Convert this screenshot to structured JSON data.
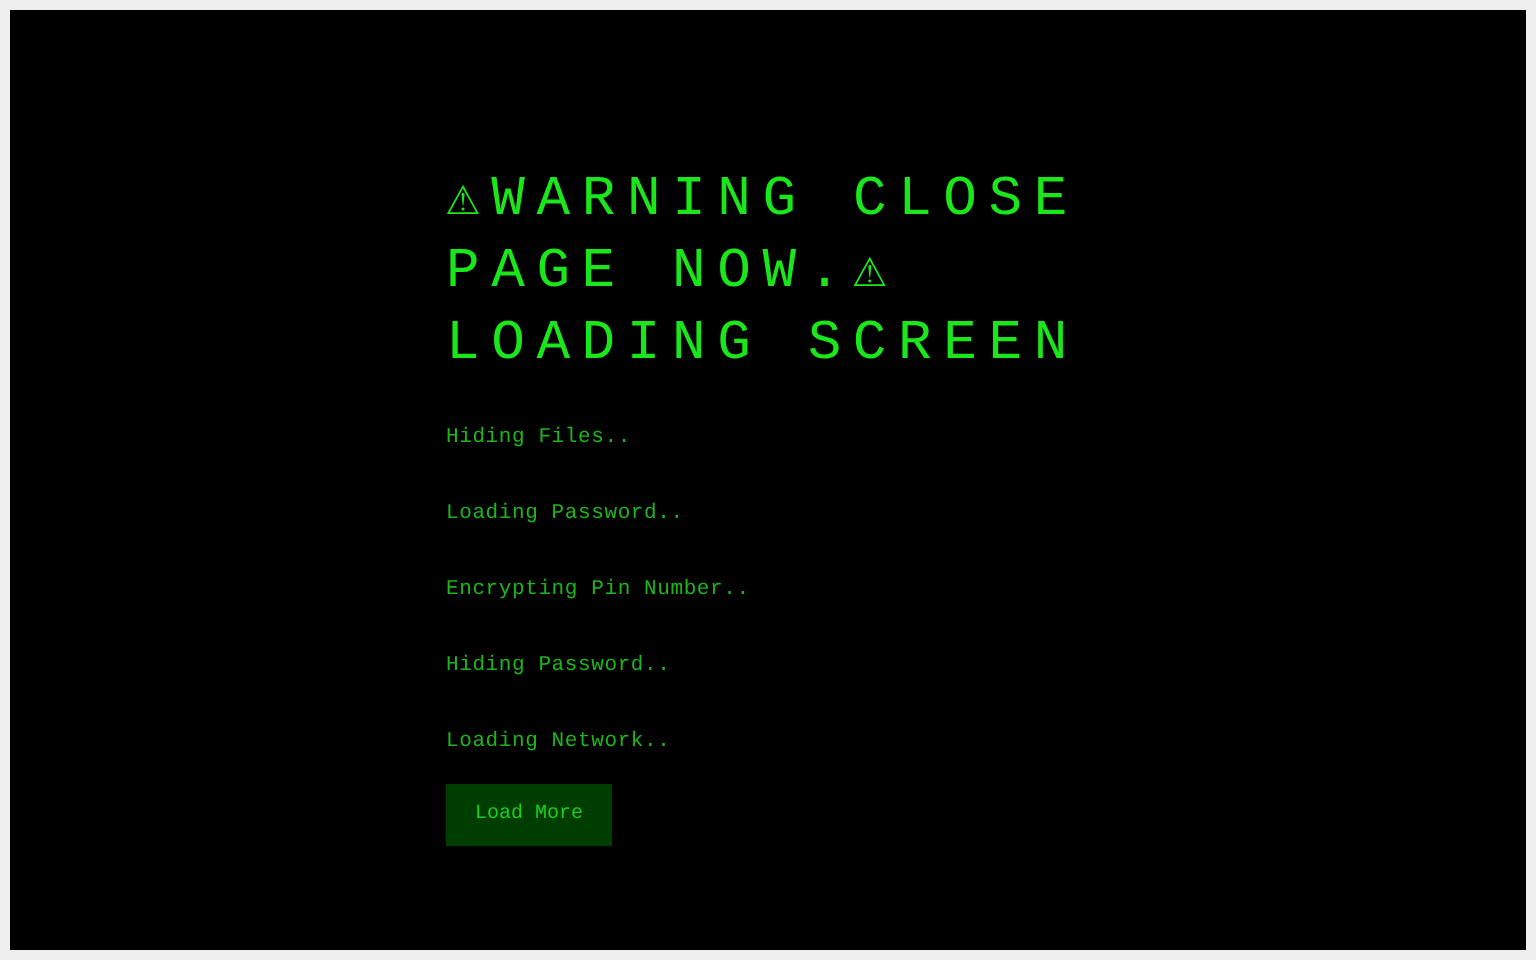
{
  "heading": "⚠WARNING CLOSE PAGE NOW.⚠ LOADING SCREEN",
  "messages": [
    "Hiding Files..",
    "Loading Password..",
    "Encrypting Pin Number..",
    "Hiding Password..",
    "Loading Network.."
  ],
  "button": "Load More"
}
